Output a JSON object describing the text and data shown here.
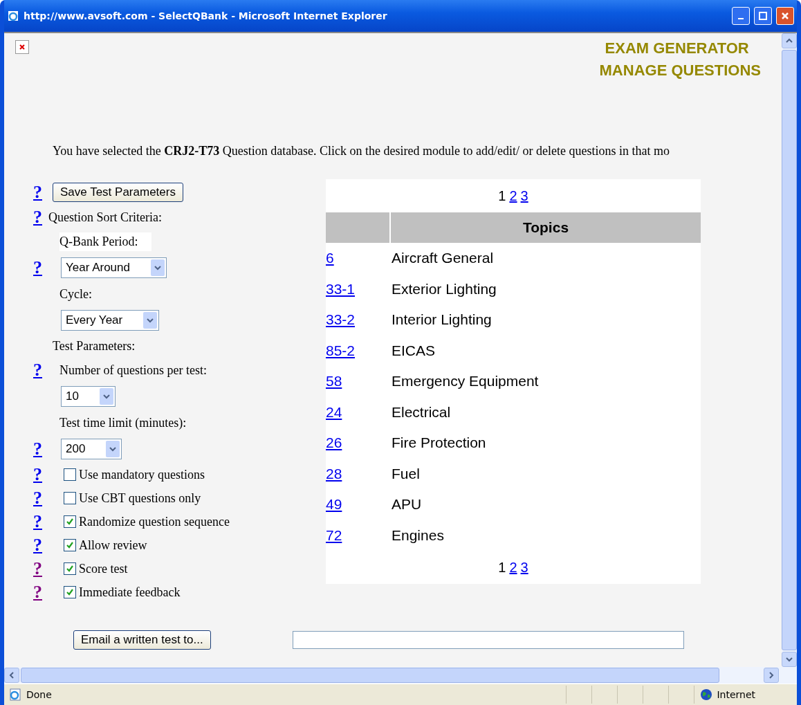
{
  "window": {
    "title": "http://www.avsoft.com - SelectQBank - Microsoft Internet Explorer"
  },
  "header": {
    "headings": [
      "EXAM GENERATOR",
      "MANAGE QUESTIONS"
    ]
  },
  "intro": "You have selected the **CRJ2-T73** Question database. Click on the desired module to add/edit/ or delete questions in that mo",
  "settings": [
    {
      "kind": "button",
      "help": {
        "mark": "?",
        "visited": false
      },
      "label": "Save Test Parameters"
    },
    {
      "kind": "heading",
      "help": {
        "mark": "?",
        "visited": false
      },
      "label": "Question Sort Criteria:"
    },
    {
      "kind": "label",
      "label": "Q-Bank Period:"
    },
    {
      "kind": "select",
      "help": {
        "mark": "?",
        "visited": false
      },
      "value": "Year Around"
    },
    {
      "kind": "label",
      "label": "Cycle:"
    },
    {
      "kind": "select",
      "value": "Every Year"
    },
    {
      "kind": "heading",
      "label": "Test Parameters:"
    },
    {
      "kind": "label",
      "help": {
        "mark": "?",
        "visited": false
      },
      "label": "Number of questions per test:"
    },
    {
      "kind": "select",
      "value": "10"
    },
    {
      "kind": "label",
      "label": "Test time limit (minutes):"
    },
    {
      "kind": "select",
      "help": {
        "mark": "?",
        "visited": false
      },
      "value": "200"
    },
    {
      "kind": "checkbox",
      "help": {
        "mark": "?",
        "visited": false
      },
      "label": "Use mandatory questions",
      "checked": false
    },
    {
      "kind": "checkbox",
      "help": {
        "mark": "?",
        "visited": false
      },
      "label": "Use CBT questions only",
      "checked": false
    },
    {
      "kind": "checkbox",
      "help": {
        "mark": "?",
        "visited": false
      },
      "label": "Randomize question sequence",
      "checked": true
    },
    {
      "kind": "checkbox",
      "help": {
        "mark": "?",
        "visited": false
      },
      "label": "Allow review",
      "checked": true
    },
    {
      "kind": "checkbox",
      "help": {
        "mark": "?",
        "visited": true
      },
      "label": "Score test",
      "checked": true
    },
    {
      "kind": "checkbox",
      "help": {
        "mark": "?",
        "visited": true
      },
      "label": "Immediate feedback",
      "checked": true
    }
  ],
  "table": {
    "pager_top": [
      {
        "label": "1",
        "selected": true
      },
      {
        "label": "2",
        "selected": false
      },
      {
        "label": "3",
        "selected": false
      }
    ],
    "columns": [
      "Topics"
    ],
    "rows": [
      {
        "code": "6",
        "topic": "Aircraft General"
      },
      {
        "code": "33-1",
        "topic": "Exterior Lighting"
      },
      {
        "code": "33-2",
        "topic": "Interior Lighting"
      },
      {
        "code": "85-2",
        "topic": "EICAS"
      },
      {
        "code": "58",
        "topic": "Emergency Equipment"
      },
      {
        "code": "24",
        "topic": "Electrical"
      },
      {
        "code": "26",
        "topic": "Fire Protection"
      },
      {
        "code": "28",
        "topic": "Fuel"
      },
      {
        "code": "49",
        "topic": "APU"
      },
      {
        "code": "72",
        "topic": "Engines"
      }
    ],
    "pager_bottom": [
      {
        "label": "1",
        "selected": true
      },
      {
        "label": "2",
        "selected": false
      },
      {
        "label": "3",
        "selected": false
      }
    ]
  },
  "email": {
    "button": "Email a written test to..."
  },
  "status_bar": {
    "status": "Done",
    "zone": "Internet"
  }
}
